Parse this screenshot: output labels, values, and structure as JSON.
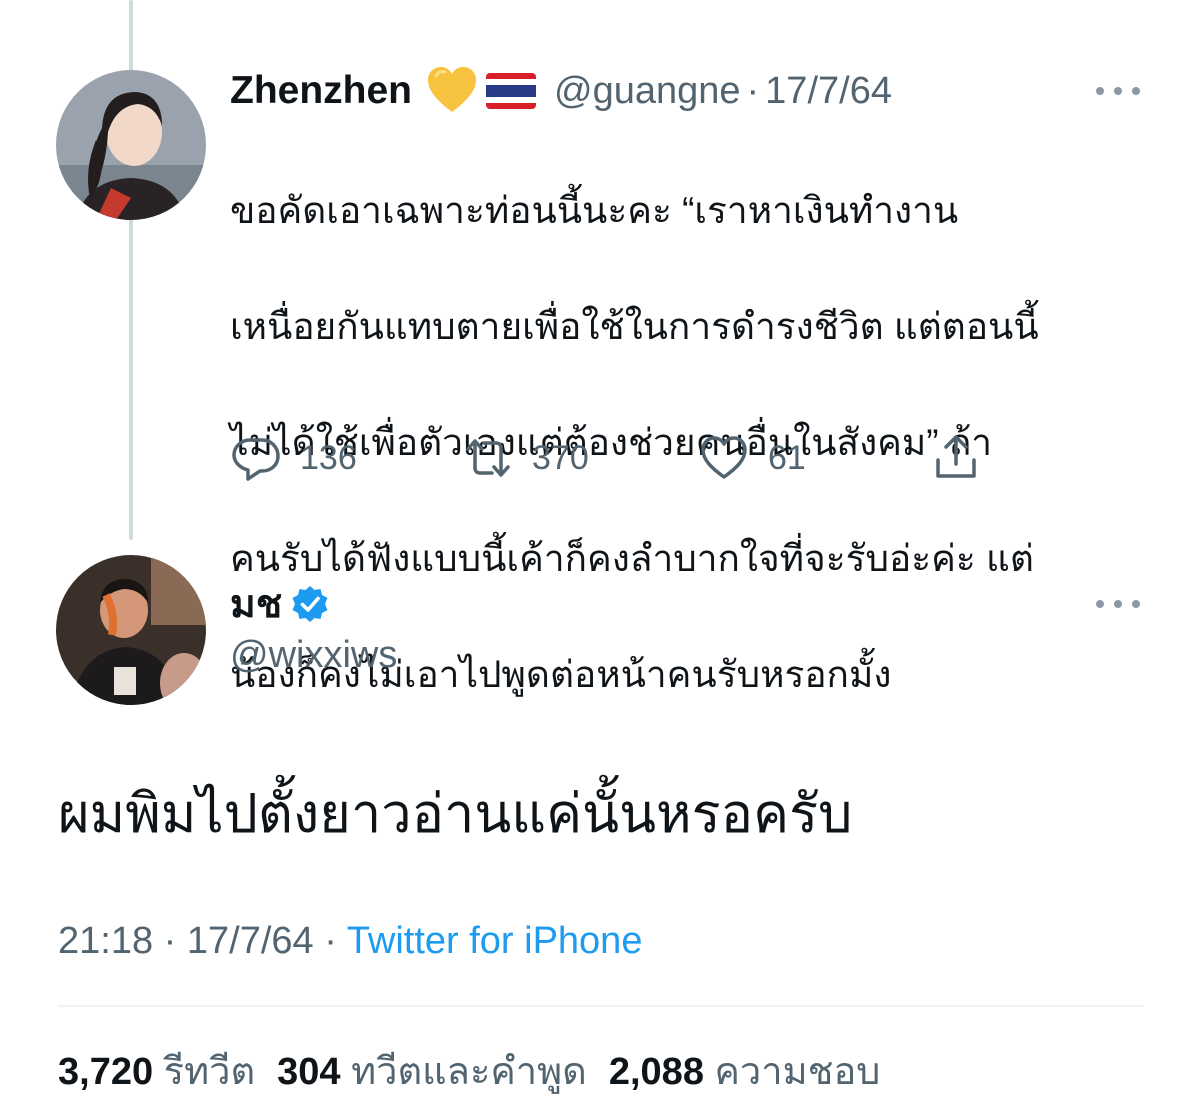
{
  "reply_tweet": {
    "display_name": "Zhenzhen",
    "emoji_icons": [
      "yellow-heart-icon",
      "thailand-flag-icon"
    ],
    "handle": "@guangne",
    "separator": "·",
    "date": "17/7/64",
    "text_lines": [
      "ขอคัดเอาเฉพาะท่อนนี้นะคะ “เราหาเงินทำงาน",
      "เหนื่อยกันแทบตายเพื่อใช้ในการดำรงชีวิต แต่ตอนนี้",
      "ไม่ได้ใช้เพื่อตัวเองแต่ต้องช่วยคนอื่นในสังคม” ถ้า",
      "คนรับได้ฟังแบบนี้เค้าก็คงลำบากใจที่จะรับอ่ะค่ะ แต่",
      "น้องก็คงไม่เอาไปพูดต่อหน้าคนรับหรอกมั้ง"
    ],
    "actions": {
      "reply_count": "136",
      "retweet_count": "370",
      "like_count": "61"
    }
  },
  "main_tweet": {
    "display_name": "มช",
    "handle": "@wixxiws",
    "text": "ผมพิมไปตั้งยาวอ่านแค่นั้นหรอครับ",
    "time": "21:18",
    "separator": "·",
    "date": "17/7/64",
    "source": "Twitter for iPhone",
    "stats": {
      "retweets": "3,720",
      "retweets_label": "รีทวีต",
      "quotes": "304",
      "quotes_label": "ทวีตและคำพูด",
      "likes": "2,088",
      "likes_label": "ความชอบ"
    }
  },
  "colors": {
    "text_primary": "#0f1419",
    "text_secondary": "#536471",
    "link_blue": "#1d9bf0",
    "thread_line": "#cfd9de"
  }
}
